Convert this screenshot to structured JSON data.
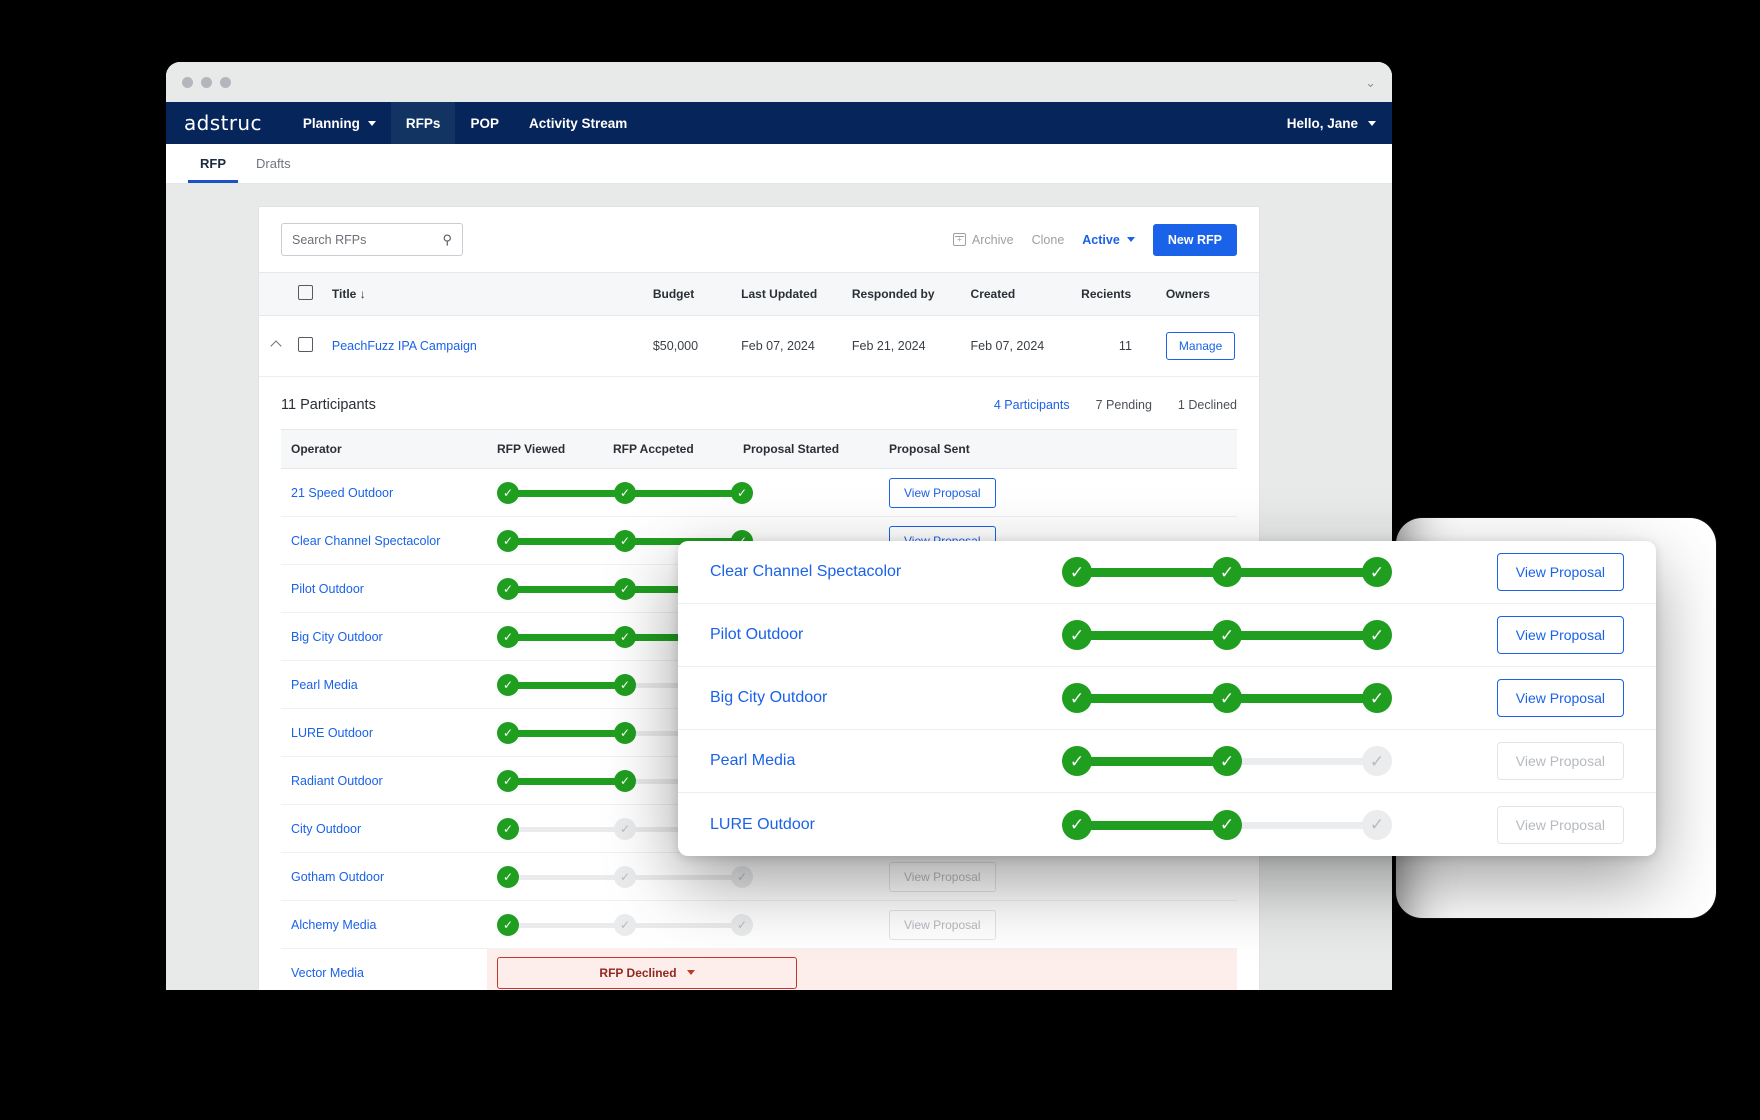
{
  "window": {
    "traffic_lights": [
      "close",
      "minimize",
      "maximize"
    ],
    "chevron": "⌄"
  },
  "navbar": {
    "brand": "adstruc",
    "items": [
      {
        "label": "Planning",
        "has_caret": true,
        "active": false
      },
      {
        "label": "RFPs",
        "has_caret": false,
        "active": true
      },
      {
        "label": "POP",
        "has_caret": false,
        "active": false
      },
      {
        "label": "Activity Stream",
        "has_caret": false,
        "active": false
      }
    ],
    "user": "Hello, Jane"
  },
  "subtabs": [
    {
      "label": "RFP",
      "active": true
    },
    {
      "label": "Drafts",
      "active": false
    }
  ],
  "toolbar": {
    "search_placeholder": "Search RFPs",
    "search_value": "",
    "search_icon": "search-icon",
    "archive_label": "Archive",
    "clone_label": "Clone",
    "status_label": "Active",
    "new_rfp_label": "New RFP"
  },
  "rfp_table": {
    "columns": [
      "Title",
      "Budget",
      "Last Updated",
      "Responded by",
      "Created",
      "Recients",
      "Owners"
    ],
    "sort_indicator": "↓",
    "rows": [
      {
        "title": "PeachFuzz IPA Campaign",
        "budget": "$50,000",
        "last_updated": "Feb 07, 2024",
        "responded_by": "Feb 21, 2024",
        "created": "Feb 07, 2024",
        "recients": "11",
        "owners_action": "Manage"
      }
    ]
  },
  "participants": {
    "count_label": "11 Participants",
    "stats": [
      {
        "label": "4 Participants",
        "highlight": true
      },
      {
        "label": "7 Pending",
        "highlight": false
      },
      {
        "label": "1 Declined",
        "highlight": false
      }
    ],
    "columns": [
      "Operator",
      "RFP Viewed",
      "RFP Accpeted",
      "Proposal Started",
      "Proposal Sent"
    ],
    "view_proposal_label": "View Proposal",
    "declined_label": "RFP Declined",
    "rows": [
      {
        "operator": "21 Speed Outdoor",
        "progress": 3,
        "declined": false,
        "action_enabled": true
      },
      {
        "operator": "Clear Channel Spectacolor",
        "progress": 3,
        "declined": false,
        "action_enabled": true
      },
      {
        "operator": "Pilot Outdoor",
        "progress": 3,
        "declined": false,
        "action_enabled": true
      },
      {
        "operator": "Big City Outdoor",
        "progress": 3,
        "declined": false,
        "action_enabled": true
      },
      {
        "operator": "Pearl Media",
        "progress": 2,
        "declined": false,
        "action_enabled": false
      },
      {
        "operator": "LURE Outdoor",
        "progress": 2,
        "declined": false,
        "action_enabled": false
      },
      {
        "operator": "Radiant Outdoor",
        "progress": 2,
        "declined": false,
        "action_enabled": false
      },
      {
        "operator": "City Outdoor",
        "progress": 1,
        "declined": false,
        "action_enabled": false
      },
      {
        "operator": "Gotham Outdoor",
        "progress": 1,
        "declined": false,
        "action_enabled": false
      },
      {
        "operator": "Alchemy Media",
        "progress": 1,
        "declined": false,
        "action_enabled": false
      },
      {
        "operator": "Vector Media",
        "progress": 0,
        "declined": true,
        "action_enabled": false
      }
    ]
  },
  "overlay": {
    "view_proposal_label": "View Proposal",
    "rows": [
      {
        "operator": "Clear Channel Spectacolor",
        "progress": 3,
        "action_enabled": true
      },
      {
        "operator": "Pilot Outdoor",
        "progress": 3,
        "action_enabled": true
      },
      {
        "operator": "Big City Outdoor",
        "progress": 3,
        "action_enabled": true
      },
      {
        "operator": "Pearl Media",
        "progress": 2,
        "action_enabled": false
      },
      {
        "operator": "LURE Outdoor",
        "progress": 2,
        "action_enabled": false
      }
    ]
  },
  "colors": {
    "navbar_bg": "#06255a",
    "accent_blue": "#1a62e8",
    "progress_green": "#1f9e1f",
    "rail_grey": "#e9ebec",
    "declined_red": "#c0392b",
    "declined_bg": "#fdeeec"
  }
}
